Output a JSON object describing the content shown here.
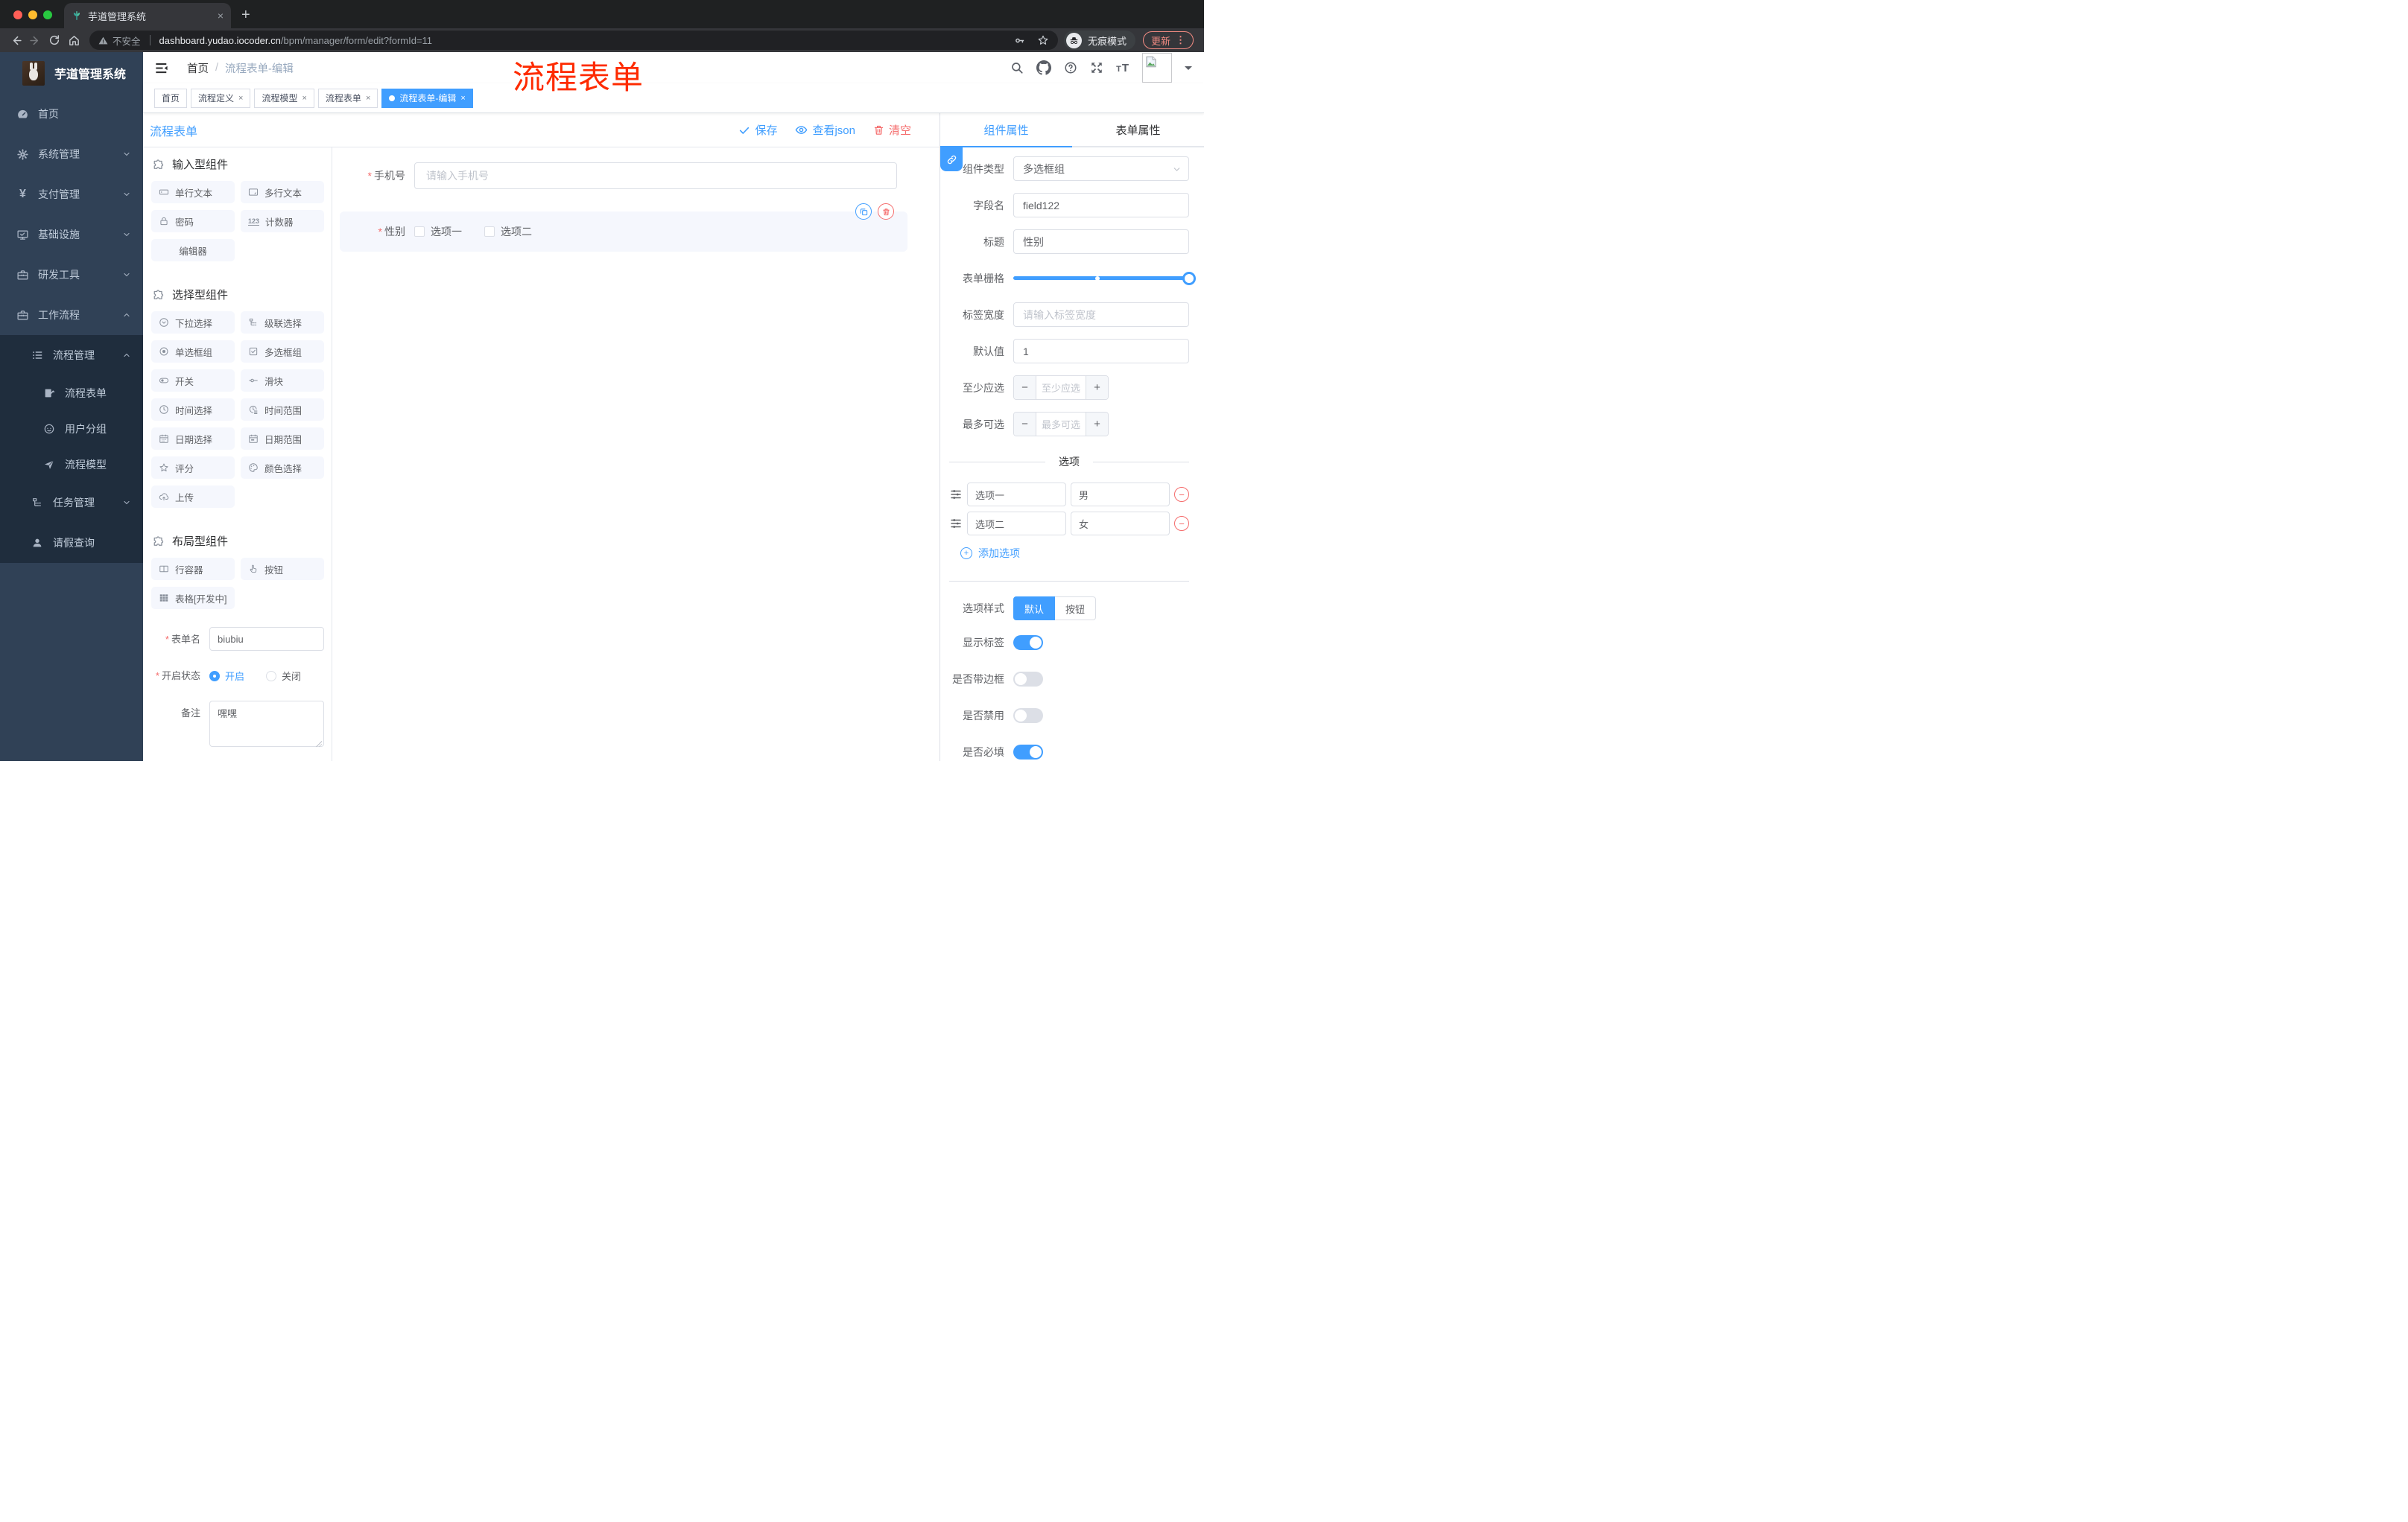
{
  "browser": {
    "tab_title": "芋道管理系统",
    "security_label": "不安全",
    "url_host": "dashboard.yudao.iocoder.cn",
    "url_path": "/bpm/manager/form/edit?formId=11",
    "incognito_label": "无痕模式",
    "update_label": "更新"
  },
  "annotation": {
    "text": "流程表单",
    "color": "#fe2b00"
  },
  "sidebar": {
    "logo_title": "芋道管理系统",
    "home": "首页",
    "system": "系统管理",
    "payment": "支付管理",
    "infrastructure": "基础设施",
    "devtools": "研发工具",
    "workflow": "工作流程",
    "process_mgmt": "流程管理",
    "process_form": "流程表单",
    "user_group": "用户分组",
    "process_model": "流程模型",
    "task_mgmt": "任务管理",
    "leave_query": "请假查询"
  },
  "header": {
    "breadcrumb_home": "首页",
    "breadcrumb_sep": "/",
    "breadcrumb_current": "流程表单-编辑"
  },
  "tags": [
    {
      "label": "首页"
    },
    {
      "label": "流程定义"
    },
    {
      "label": "流程模型"
    },
    {
      "label": "流程表单"
    },
    {
      "label": "流程表单-编辑"
    }
  ],
  "toolbar": {
    "title": "流程表单",
    "save_label": "保存",
    "view_json_label": "查看json",
    "clear_label": "清空"
  },
  "palette": {
    "input_section": "输入型组件",
    "select_section": "选择型组件",
    "layout_section": "布局型组件",
    "items": {
      "single_text": "单行文本",
      "multi_text": "多行文本",
      "password": "密码",
      "counter": "计数器",
      "editor": "编辑器",
      "select": "下拉选择",
      "cascader": "级联选择",
      "radio_group": "单选框组",
      "checkbox_group": "多选框组",
      "switch": "开关",
      "slider": "滑块",
      "time": "时间选择",
      "time_range": "时间范围",
      "date": "日期选择",
      "date_range": "日期范围",
      "rate": "评分",
      "color": "颜色选择",
      "upload": "上传",
      "row": "行容器",
      "button": "按钮",
      "table": "表格[开发中]"
    }
  },
  "form_meta": {
    "name_label": "表单名",
    "name_value": "biubiu",
    "status_label": "开启状态",
    "status_on": "开启",
    "status_off": "关闭",
    "remark_label": "备注",
    "remark_value": "嘿嘿"
  },
  "canvas": {
    "phone_label": "手机号",
    "phone_placeholder": "请输入手机号",
    "gender_label": "性别",
    "gender_option1": "选项一",
    "gender_option2": "选项二"
  },
  "panel": {
    "tab_component": "组件属性",
    "tab_form": "表单属性",
    "component_type_label": "组件类型",
    "component_type_value": "多选框组",
    "field_name_label": "字段名",
    "field_name_value": "field122",
    "title_label": "标题",
    "title_value": "性别",
    "grid_label": "表单栅格",
    "label_width_label": "标签宽度",
    "label_width_placeholder": "请输入标签宽度",
    "default_label": "默认值",
    "default_value": "1",
    "min_label": "至少应选",
    "min_placeholder": "至少应选",
    "max_label": "最多可选",
    "max_placeholder": "最多可选",
    "options_title": "选项",
    "options": [
      {
        "label": "选项一",
        "value": "男"
      },
      {
        "label": "选项二",
        "value": "女"
      }
    ],
    "add_option_label": "添加选项",
    "style_label": "选项样式",
    "style_default": "默认",
    "style_button": "按钮",
    "show_label_label": "显示标签",
    "border_label": "是否带边框",
    "disabled_label": "是否禁用",
    "required_label": "是否必填"
  },
  "colors": {
    "accent": "#409eff",
    "danger": "#f56c6c",
    "sidebar": "#304156"
  }
}
